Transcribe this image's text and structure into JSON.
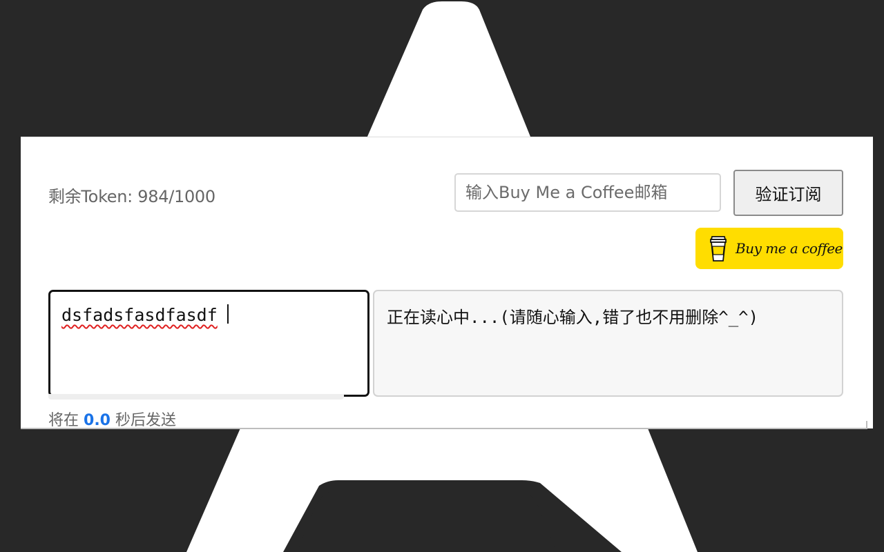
{
  "token": {
    "text": "剩余Token: 984/1000"
  },
  "subscription": {
    "email_placeholder": "输入Buy Me a Coffee邮箱",
    "email_value": "",
    "verify_label": "验证订阅"
  },
  "bmc": {
    "label": "Buy me a coffee",
    "color": "#ffdd00"
  },
  "editor": {
    "input_text": "dsfadsfasdfasdf",
    "output_text": "正在读心中...(请随心输入,错了也不用删除^_^)"
  },
  "countdown": {
    "prefix": "将在",
    "value": "0.0",
    "suffix": "秒后发送"
  },
  "colors": {
    "accent": "#1a73e8",
    "background": "#282828"
  }
}
